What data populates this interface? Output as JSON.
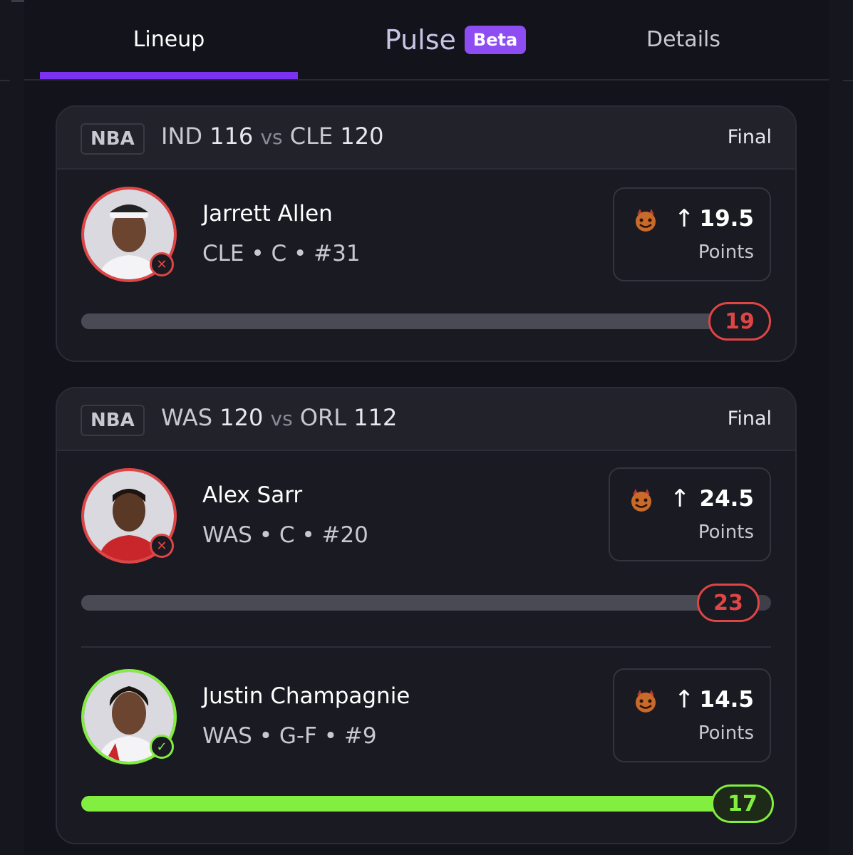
{
  "tabs": {
    "lineup": "Lineup",
    "pulse": "Pulse",
    "pulse_badge": "Beta",
    "details": "Details"
  },
  "colors": {
    "accent": "#7a32f0",
    "miss": "#e04545",
    "hit": "#82ee40"
  },
  "games": [
    {
      "league": "NBA",
      "team1": "IND",
      "score1": "116",
      "vs": "vs",
      "team2": "CLE",
      "score2": "120",
      "status": "Final",
      "players": [
        {
          "name": "Jarrett Allen",
          "meta": "CLE • C • #31",
          "icon": "devil-icon",
          "direction": "up-arrow-icon",
          "line": "19.5",
          "stat": "Points",
          "actual": "19",
          "progress": 0.974,
          "result": "miss"
        }
      ]
    },
    {
      "league": "NBA",
      "team1": "WAS",
      "score1": "120",
      "vs": "vs",
      "team2": "ORL",
      "score2": "112",
      "status": "Final",
      "players": [
        {
          "name": "Alex Sarr",
          "meta": "WAS • C • #20",
          "icon": "devil-icon",
          "direction": "up-arrow-icon",
          "line": "24.5",
          "stat": "Points",
          "actual": "23",
          "progress": 0.939,
          "result": "miss"
        },
        {
          "name": "Justin Champagnie",
          "meta": "WAS • G-F • #9",
          "icon": "devil-icon",
          "direction": "up-arrow-icon",
          "line": "14.5",
          "stat": "Points",
          "actual": "17",
          "progress": 1.0,
          "result": "hit"
        }
      ]
    }
  ]
}
